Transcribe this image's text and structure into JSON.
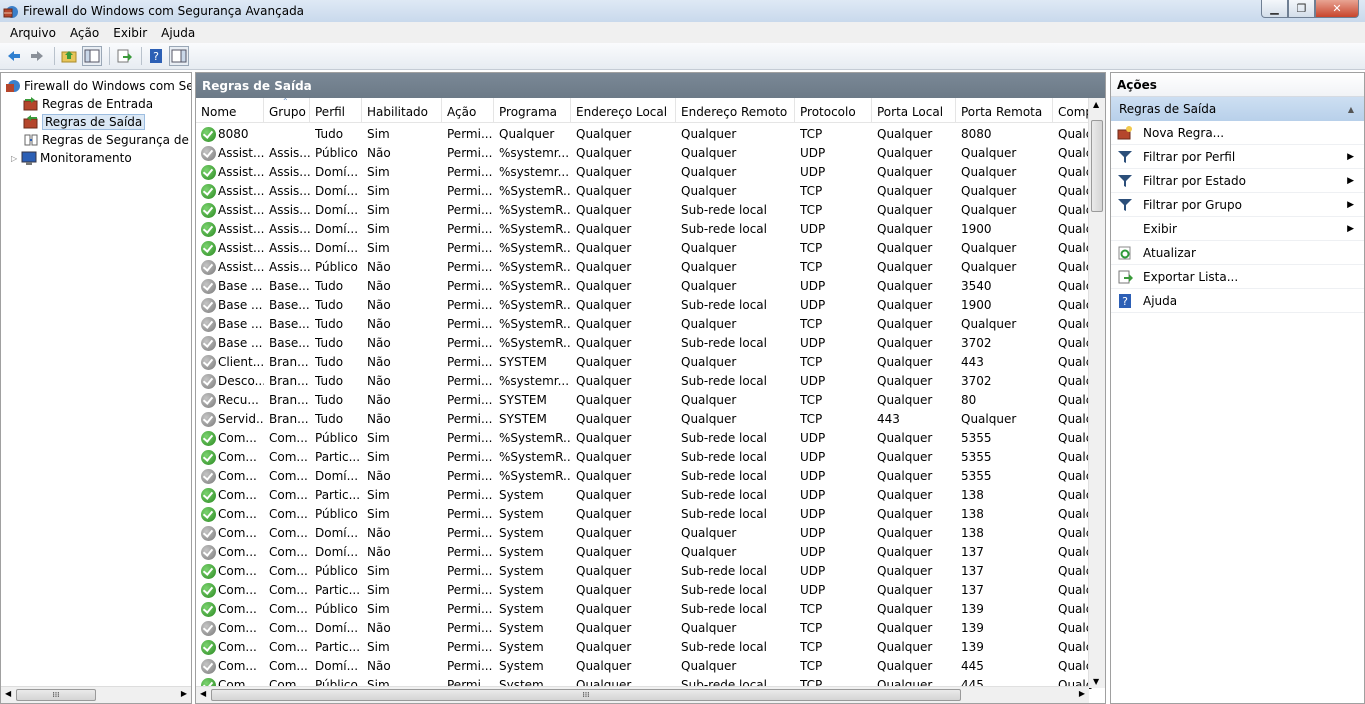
{
  "window": {
    "title": "Firewall do Windows com Segurança Avançada",
    "buttons": {
      "min": "▁",
      "max": "❐",
      "close": "✕"
    }
  },
  "menu": [
    "Arquivo",
    "Ação",
    "Exibir",
    "Ajuda"
  ],
  "toolbar_icons": [
    "back-icon",
    "forward-icon",
    "up-folder-icon",
    "show-hide-tree-icon",
    "export-icon",
    "help-icon",
    "show-hide-action-pane-icon"
  ],
  "tree": {
    "root": "Firewall do Windows com Segurança Avançada",
    "items": [
      "Regras de Entrada",
      "Regras de Saída",
      "Regras de Segurança de Conexão",
      "Monitoramento"
    ],
    "selected": "Regras de Saída",
    "scroll_arrows": {
      "left": "◀",
      "right": "▶",
      "grip": "⁞⁞⁞"
    }
  },
  "center": {
    "title": "Regras de Saída",
    "columns": [
      "Nome",
      "Grupo",
      "Perfil",
      "Habilitado",
      "Ação",
      "Programa",
      "Endereço Local",
      "Endereço Remoto",
      "Protocolo",
      "Porta Local",
      "Porta Remota",
      "Comp"
    ],
    "rows": [
      {
        "on": true,
        "c": [
          "8080",
          "",
          "Tudo",
          "Sim",
          "Permi...",
          "Qualquer",
          "Qualquer",
          "Qualquer",
          "TCP",
          "Qualquer",
          "8080",
          "Qualc"
        ]
      },
      {
        "on": false,
        "c": [
          "Assist...",
          "Assis...",
          "Público",
          "Não",
          "Permi...",
          "%systemr...",
          "Qualquer",
          "Qualquer",
          "UDP",
          "Qualquer",
          "Qualquer",
          "Qualc"
        ]
      },
      {
        "on": true,
        "c": [
          "Assist...",
          "Assis...",
          "Domí...",
          "Sim",
          "Permi...",
          "%systemr...",
          "Qualquer",
          "Qualquer",
          "UDP",
          "Qualquer",
          "Qualquer",
          "Qualc"
        ]
      },
      {
        "on": true,
        "c": [
          "Assist...",
          "Assis...",
          "Domí...",
          "Sim",
          "Permi...",
          "%SystemR...",
          "Qualquer",
          "Qualquer",
          "TCP",
          "Qualquer",
          "Qualquer",
          "Qualc"
        ]
      },
      {
        "on": true,
        "c": [
          "Assist...",
          "Assis...",
          "Domí...",
          "Sim",
          "Permi...",
          "%SystemR...",
          "Qualquer",
          "Sub-rede local",
          "TCP",
          "Qualquer",
          "Qualquer",
          "Qualc"
        ]
      },
      {
        "on": true,
        "c": [
          "Assist...",
          "Assis...",
          "Domí...",
          "Sim",
          "Permi...",
          "%SystemR...",
          "Qualquer",
          "Sub-rede local",
          "UDP",
          "Qualquer",
          "1900",
          "Qualc"
        ]
      },
      {
        "on": true,
        "c": [
          "Assist...",
          "Assis...",
          "Domí...",
          "Sim",
          "Permi...",
          "%SystemR...",
          "Qualquer",
          "Qualquer",
          "TCP",
          "Qualquer",
          "Qualquer",
          "Qualc"
        ]
      },
      {
        "on": false,
        "c": [
          "Assist...",
          "Assis...",
          "Público",
          "Não",
          "Permi...",
          "%SystemR...",
          "Qualquer",
          "Qualquer",
          "TCP",
          "Qualquer",
          "Qualquer",
          "Qualc"
        ]
      },
      {
        "on": false,
        "c": [
          "Base ...",
          "Base...",
          "Tudo",
          "Não",
          "Permi...",
          "%SystemR...",
          "Qualquer",
          "Qualquer",
          "UDP",
          "Qualquer",
          "3540",
          "Qualc"
        ]
      },
      {
        "on": false,
        "c": [
          "Base ...",
          "Base...",
          "Tudo",
          "Não",
          "Permi...",
          "%SystemR...",
          "Qualquer",
          "Sub-rede local",
          "UDP",
          "Qualquer",
          "1900",
          "Qualc"
        ]
      },
      {
        "on": false,
        "c": [
          "Base ...",
          "Base...",
          "Tudo",
          "Não",
          "Permi...",
          "%SystemR...",
          "Qualquer",
          "Qualquer",
          "TCP",
          "Qualquer",
          "Qualquer",
          "Qualc"
        ]
      },
      {
        "on": false,
        "c": [
          "Base ...",
          "Base...",
          "Tudo",
          "Não",
          "Permi...",
          "%SystemR...",
          "Qualquer",
          "Sub-rede local",
          "UDP",
          "Qualquer",
          "3702",
          "Qualc"
        ]
      },
      {
        "on": false,
        "c": [
          "Client...",
          "Bran...",
          "Tudo",
          "Não",
          "Permi...",
          "SYSTEM",
          "Qualquer",
          "Qualquer",
          "TCP",
          "Qualquer",
          "443",
          "Qualc"
        ]
      },
      {
        "on": false,
        "c": [
          "Desco...",
          "Bran...",
          "Tudo",
          "Não",
          "Permi...",
          "%systemr...",
          "Qualquer",
          "Sub-rede local",
          "UDP",
          "Qualquer",
          "3702",
          "Qualc"
        ]
      },
      {
        "on": false,
        "c": [
          "Recu...",
          "Bran...",
          "Tudo",
          "Não",
          "Permi...",
          "SYSTEM",
          "Qualquer",
          "Qualquer",
          "TCP",
          "Qualquer",
          "80",
          "Qualc"
        ]
      },
      {
        "on": false,
        "c": [
          "Servid...",
          "Bran...",
          "Tudo",
          "Não",
          "Permi...",
          "SYSTEM",
          "Qualquer",
          "Qualquer",
          "TCP",
          "443",
          "Qualquer",
          "Qualc"
        ]
      },
      {
        "on": true,
        "c": [
          "Com...",
          "Com...",
          "Público",
          "Sim",
          "Permi...",
          "%SystemR...",
          "Qualquer",
          "Sub-rede local",
          "UDP",
          "Qualquer",
          "5355",
          "Qualc"
        ]
      },
      {
        "on": true,
        "c": [
          "Com...",
          "Com...",
          "Partic...",
          "Sim",
          "Permi...",
          "%SystemR...",
          "Qualquer",
          "Sub-rede local",
          "UDP",
          "Qualquer",
          "5355",
          "Qualc"
        ]
      },
      {
        "on": false,
        "c": [
          "Com...",
          "Com...",
          "Domí...",
          "Não",
          "Permi...",
          "%SystemR...",
          "Qualquer",
          "Sub-rede local",
          "UDP",
          "Qualquer",
          "5355",
          "Qualc"
        ]
      },
      {
        "on": true,
        "c": [
          "Com...",
          "Com...",
          "Partic...",
          "Sim",
          "Permi...",
          "System",
          "Qualquer",
          "Sub-rede local",
          "UDP",
          "Qualquer",
          "138",
          "Qualc"
        ]
      },
      {
        "on": true,
        "c": [
          "Com...",
          "Com...",
          "Público",
          "Sim",
          "Permi...",
          "System",
          "Qualquer",
          "Sub-rede local",
          "UDP",
          "Qualquer",
          "138",
          "Qualc"
        ]
      },
      {
        "on": false,
        "c": [
          "Com...",
          "Com...",
          "Domí...",
          "Não",
          "Permi...",
          "System",
          "Qualquer",
          "Qualquer",
          "UDP",
          "Qualquer",
          "138",
          "Qualc"
        ]
      },
      {
        "on": false,
        "c": [
          "Com...",
          "Com...",
          "Domí...",
          "Não",
          "Permi...",
          "System",
          "Qualquer",
          "Qualquer",
          "UDP",
          "Qualquer",
          "137",
          "Qualc"
        ]
      },
      {
        "on": true,
        "c": [
          "Com...",
          "Com...",
          "Público",
          "Sim",
          "Permi...",
          "System",
          "Qualquer",
          "Sub-rede local",
          "UDP",
          "Qualquer",
          "137",
          "Qualc"
        ]
      },
      {
        "on": true,
        "c": [
          "Com...",
          "Com...",
          "Partic...",
          "Sim",
          "Permi...",
          "System",
          "Qualquer",
          "Sub-rede local",
          "UDP",
          "Qualquer",
          "137",
          "Qualc"
        ]
      },
      {
        "on": true,
        "c": [
          "Com...",
          "Com...",
          "Público",
          "Sim",
          "Permi...",
          "System",
          "Qualquer",
          "Sub-rede local",
          "TCP",
          "Qualquer",
          "139",
          "Qualc"
        ]
      },
      {
        "on": false,
        "c": [
          "Com...",
          "Com...",
          "Domí...",
          "Não",
          "Permi...",
          "System",
          "Qualquer",
          "Qualquer",
          "TCP",
          "Qualquer",
          "139",
          "Qualc"
        ]
      },
      {
        "on": true,
        "c": [
          "Com...",
          "Com...",
          "Partic...",
          "Sim",
          "Permi...",
          "System",
          "Qualquer",
          "Sub-rede local",
          "TCP",
          "Qualquer",
          "139",
          "Qualc"
        ]
      },
      {
        "on": false,
        "c": [
          "Com...",
          "Com...",
          "Domí...",
          "Não",
          "Permi...",
          "System",
          "Qualquer",
          "Qualquer",
          "TCP",
          "Qualquer",
          "445",
          "Qualc"
        ]
      },
      {
        "on": true,
        "c": [
          "Com...",
          "Com...",
          "Público",
          "Sim",
          "Permi...",
          "System",
          "Qualquer",
          "Sub-rede local",
          "TCP",
          "Qualquer",
          "445",
          "Qualc"
        ]
      }
    ],
    "scroll_arrows": {
      "up": "▲",
      "down": "▼",
      "left": "◀",
      "right": "▶",
      "grip": "⁞⁞⁞"
    }
  },
  "actions": {
    "title": "Ações",
    "section": "Regras de Saída",
    "collapse_arrow": "▲",
    "submenu_arrow": "▶",
    "items": [
      {
        "label": "Nova Regra...",
        "icon": "new-rule-icon"
      },
      {
        "label": "Filtrar por Perfil",
        "icon": "filter-icon",
        "sub": true
      },
      {
        "label": "Filtrar por Estado",
        "icon": "filter-icon",
        "sub": true
      },
      {
        "label": "Filtrar por Grupo",
        "icon": "filter-icon",
        "sub": true
      },
      {
        "label": "Exibir",
        "icon": "",
        "sub": true
      },
      {
        "label": "Atualizar",
        "icon": "refresh-icon"
      },
      {
        "label": "Exportar Lista...",
        "icon": "export-list-icon"
      },
      {
        "label": "Ajuda",
        "icon": "help-icon"
      }
    ]
  },
  "colors": {
    "enabled": "#2b8a22",
    "disabled": "#7a7a7a",
    "header_bar": "#6c7a87",
    "selection": "#dbe8f5"
  }
}
